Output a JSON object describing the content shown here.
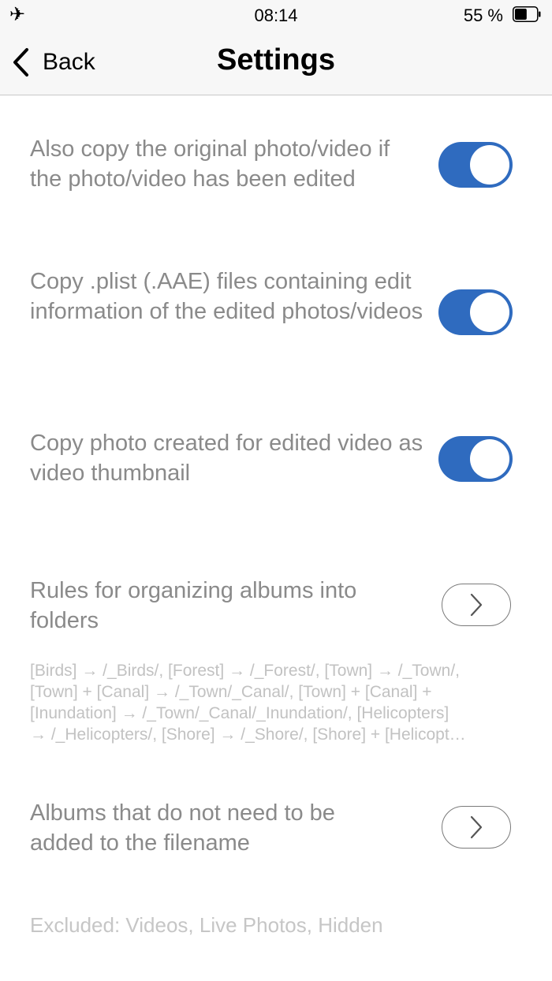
{
  "status_bar": {
    "icon": "airplane-icon",
    "time": "08:14",
    "battery": "55 %",
    "battery_level": 0.55
  },
  "nav": {
    "back_label": "Back",
    "title": "Settings"
  },
  "settings": {
    "copy_original": {
      "label": "Also copy the original photo/video if the photo/video has been edited",
      "enabled": true
    },
    "copy_plist": {
      "label": "Copy .plist (.AAE) files containing edit information of the edited photos/videos",
      "enabled": true
    },
    "copy_thumbnail": {
      "label": "Copy photo created for edited video as video thumbnail",
      "enabled": true
    },
    "rules": {
      "label": "Rules for organizing albums into folders",
      "summary": [
        "[Birds] → /_Birds/, [Forest] → /_Forest/, [Town] → /_Town/,",
        "[Town] + [Canal] → /_Town/_Canal/, [Town] + [Canal] +",
        "[Inundation] → /_Town/_Canal/_Inundation/, [Helicopters]",
        "→ /_Helicopters/, [Shore] → /_Shore/, [Shore] + [Helicopt…"
      ]
    },
    "excluded_albums": {
      "label": "Albums that do not need to be added to the filename",
      "summary": "Excluded: Videos, Live Photos, Hidden"
    }
  },
  "colors": {
    "toggle_on": "#2f6bbf",
    "label_text": "#8a8a8a",
    "summary_text": "#c2c2c2",
    "bar_background": "#f7f7f7"
  }
}
